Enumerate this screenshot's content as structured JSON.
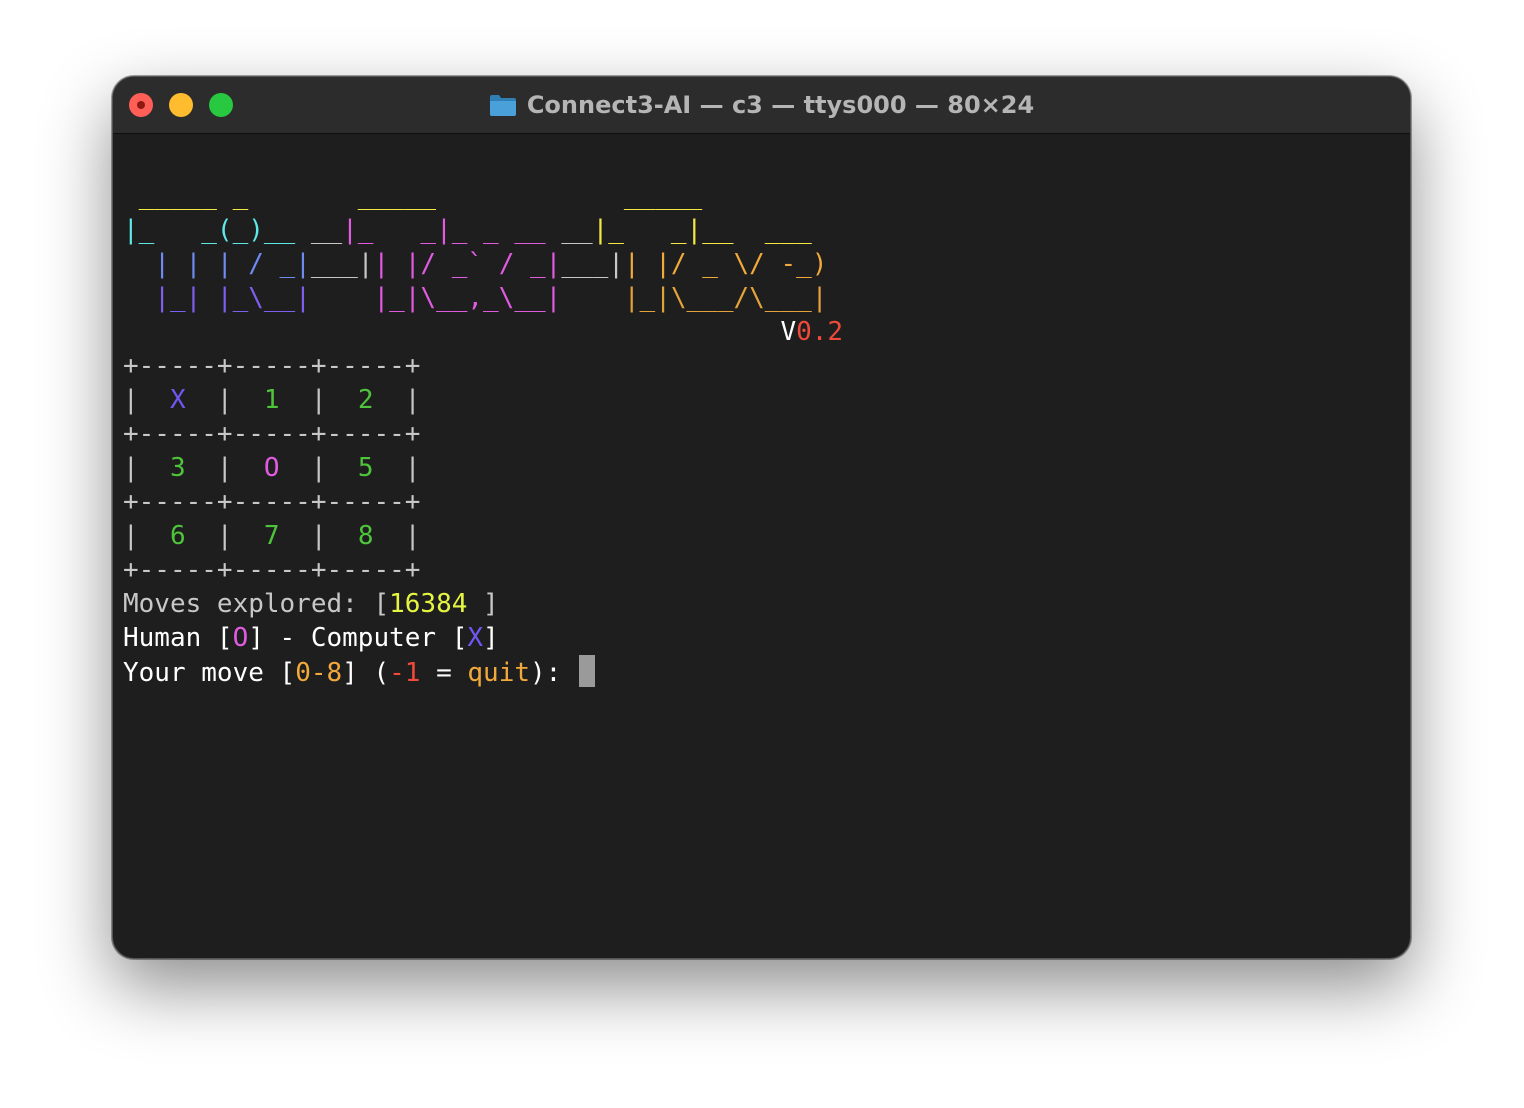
{
  "window": {
    "title": "Connect3-AI — c3 — ttys000 — 80×24",
    "folder_icon": "folder-icon"
  },
  "banner": {
    "lines": [
      [
        {
          "t": " _____ _       _____            _____",
          "c": "c-yellow"
        }
      ],
      [
        {
          "t": "|_   _(_)__ __|_   _|_ _ __ __|_   _|__  ___",
          "c": "c-cyan"
        }
      ],
      [
        {
          "t": "  | | | / _|___|| |/ _` / _|___|| |/ _ \\/ -_)",
          "c": "c-blue"
        }
      ],
      [
        {
          "t": "  |_| |_\\__|    |_|\\__,_\\__|    |_|\\___/\\___|",
          "c": "c-indigo"
        }
      ]
    ],
    "version_prefix": "V",
    "version_num": "0.2",
    "version_pad": "                                          "
  },
  "board": {
    "border": "+-----+-----+-----+",
    "rows": [
      [
        {
          "v": "X",
          "c": "c-x"
        },
        {
          "v": "1",
          "c": "c-green"
        },
        {
          "v": "2",
          "c": "c-green"
        }
      ],
      [
        {
          "v": "3",
          "c": "c-green"
        },
        {
          "v": "O",
          "c": "c-magenta"
        },
        {
          "v": "5",
          "c": "c-green"
        }
      ],
      [
        {
          "v": "6",
          "c": "c-green"
        },
        {
          "v": "7",
          "c": "c-green"
        },
        {
          "v": "8",
          "c": "c-green"
        }
      ]
    ]
  },
  "status": {
    "moves_label": "Moves explored: [",
    "moves_count": "16384",
    "moves_end": " ]",
    "human_label": "Human [",
    "human_mark": "O",
    "computer_label": "] - Computer [",
    "computer_mark": "X",
    "computer_end": "]"
  },
  "prompt": {
    "label": "Your move [",
    "range": "0-8",
    "mid": "] (",
    "quit_value": "-1",
    "equals": " = ",
    "quit_word": "quit",
    "end": "): "
  }
}
